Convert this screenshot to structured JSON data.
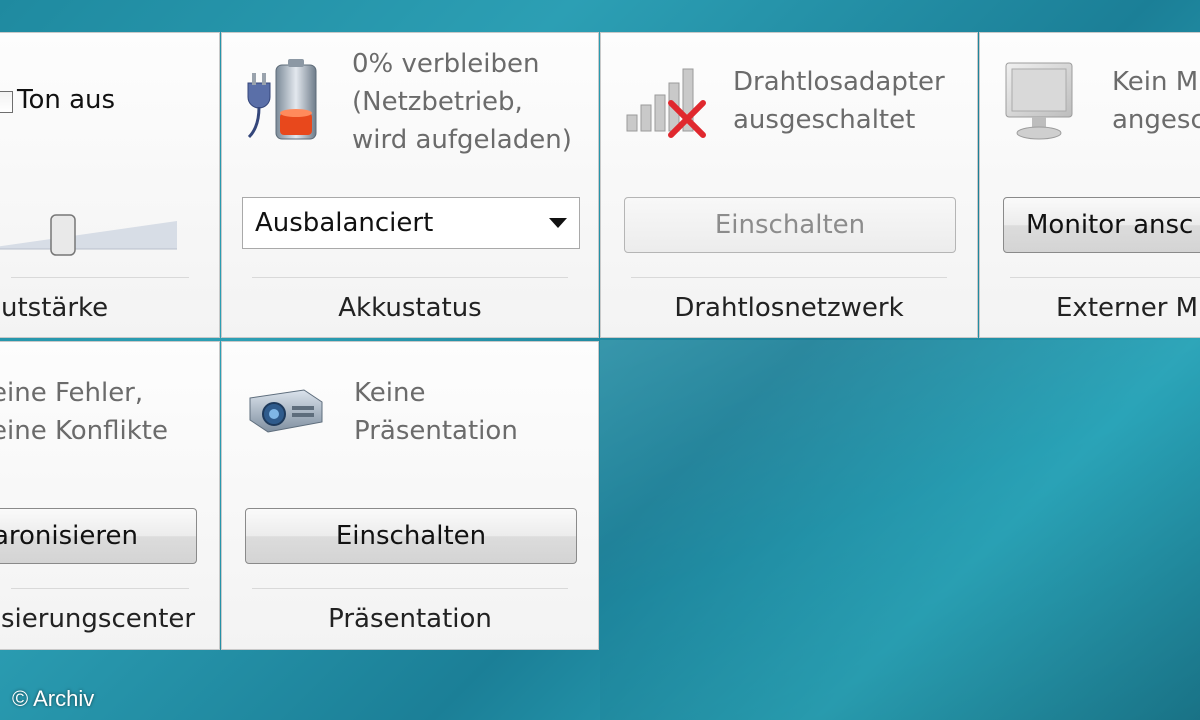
{
  "tiles": {
    "volume": {
      "mute_label": "Ton aus",
      "title": "utstärke",
      "slider_level_percent": 30
    },
    "battery": {
      "status_lines": [
        "0% verbleiben",
        "(Netzbetrieb,",
        "wird aufgeladen)"
      ],
      "plan_selected": "Ausbalanciert",
      "title": "Akkustatus"
    },
    "wireless": {
      "status_lines": [
        "Drahtlosadapter",
        "ausgeschaltet"
      ],
      "button_label": "Einschalten",
      "title": "Drahtlosnetzwerk"
    },
    "monitor": {
      "status_lines": [
        "Kein M",
        "angesc"
      ],
      "button_label": "Monitor ansc",
      "title": "Externer M"
    },
    "sync": {
      "status_lines": [
        "eine Fehler,",
        "eine Konflikte"
      ],
      "button_label": "aronisieren",
      "title": "sierungscenter"
    },
    "presentation": {
      "status_lines": [
        "Keine",
        "Präsentation"
      ],
      "button_label": "Einschalten",
      "title": "Präsentation"
    }
  },
  "watermark": "© Archiv",
  "icons": {
    "battery": "battery-plug-icon",
    "wireless": "wireless-signal-off-icon",
    "monitor": "monitor-icon",
    "presentation": "projector-icon"
  }
}
